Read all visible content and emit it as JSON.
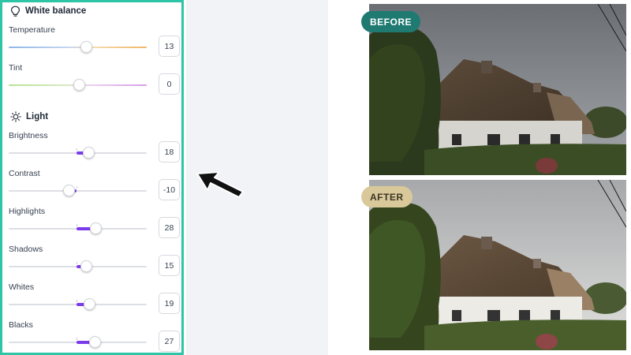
{
  "panel": {
    "white_balance": {
      "title": "White balance",
      "sliders": [
        {
          "label": "Temperature",
          "value": "13",
          "level": 13
        },
        {
          "label": "Tint",
          "value": "0",
          "level": 0
        }
      ]
    },
    "light": {
      "title": "Light",
      "sliders": [
        {
          "label": "Brightness",
          "value": "18",
          "level": 18
        },
        {
          "label": "Contrast",
          "value": "-10",
          "level": -10
        },
        {
          "label": "Highlights",
          "value": "28",
          "level": 28
        },
        {
          "label": "Shadows",
          "value": "15",
          "level": 15
        },
        {
          "label": "Whites",
          "value": "19",
          "level": 19
        },
        {
          "label": "Blacks",
          "value": "27",
          "level": 27
        }
      ]
    },
    "slider_range": [
      -100,
      100
    ],
    "accent_color": "#7c3aed",
    "border_color": "#2ec4a6"
  },
  "comparison": {
    "before_label": "BEFORE",
    "after_label": "AFTER",
    "before_badge_color": "#1f7a72",
    "after_badge_color": "#d9c89a"
  },
  "icons": {
    "white_balance": "lightbulb-icon",
    "light": "sun-icon",
    "pointer": "arrow-pointer-icon"
  }
}
